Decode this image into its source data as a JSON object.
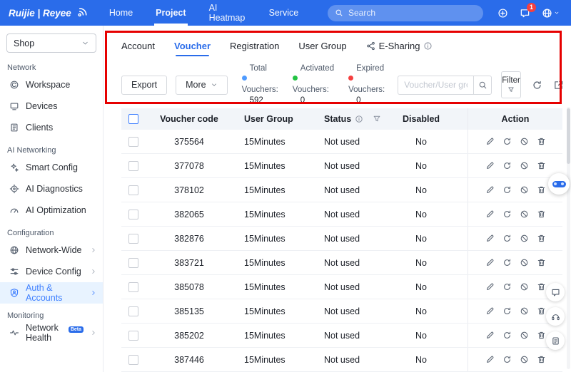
{
  "topbar": {
    "brand": "Ruijie | Reyee",
    "nav": [
      {
        "label": "Home"
      },
      {
        "label": "Project"
      },
      {
        "label": "AI Heatmap"
      },
      {
        "label": "Service"
      }
    ],
    "search_placeholder": "Search",
    "notification_badge": "1"
  },
  "sidebar": {
    "shop_selector": "Shop",
    "sections": [
      {
        "label": "Network",
        "items": [
          {
            "label": "Workspace"
          },
          {
            "label": "Devices"
          },
          {
            "label": "Clients"
          }
        ]
      },
      {
        "label": "AI Networking",
        "items": [
          {
            "label": "Smart Config"
          },
          {
            "label": "AI Diagnostics"
          },
          {
            "label": "AI Optimization"
          }
        ]
      },
      {
        "label": "Configuration",
        "items": [
          {
            "label": "Network-Wide"
          },
          {
            "label": "Device Config"
          },
          {
            "label": "Auth & Accounts"
          }
        ]
      },
      {
        "label": "Monitoring",
        "items": [
          {
            "label": "Network Health",
            "badge": "Beta"
          }
        ]
      }
    ]
  },
  "tabs": [
    {
      "label": "Account"
    },
    {
      "label": "Voucher"
    },
    {
      "label": "Registration"
    },
    {
      "label": "User Group"
    },
    {
      "label": "E-Sharing"
    }
  ],
  "toolbar": {
    "export_label": "Export",
    "more_label": "More",
    "stats": [
      {
        "line1": "Total",
        "line2": "Vouchers:",
        "value": "592",
        "color": "#4f9bff"
      },
      {
        "line1": "Activated",
        "line2": "Vouchers:",
        "value": "0",
        "color": "#23c343"
      },
      {
        "line1": "Expired",
        "line2": "Vouchers:",
        "value": "0",
        "color": "#f53f3f"
      }
    ],
    "search_placeholder": "Voucher/User group",
    "filter_label": "Filter"
  },
  "table": {
    "columns": [
      "Voucher code",
      "User Group",
      "Status",
      "Disabled",
      "Action"
    ],
    "rows": [
      {
        "code": "375564",
        "group": "15Minutes",
        "status": "Not used",
        "disabled": "No"
      },
      {
        "code": "377078",
        "group": "15Minutes",
        "status": "Not used",
        "disabled": "No"
      },
      {
        "code": "378102",
        "group": "15Minutes",
        "status": "Not used",
        "disabled": "No"
      },
      {
        "code": "382065",
        "group": "15Minutes",
        "status": "Not used",
        "disabled": "No"
      },
      {
        "code": "382876",
        "group": "15Minutes",
        "status": "Not used",
        "disabled": "No"
      },
      {
        "code": "383721",
        "group": "15Minutes",
        "status": "Not used",
        "disabled": "No"
      },
      {
        "code": "385078",
        "group": "15Minutes",
        "status": "Not used",
        "disabled": "No"
      },
      {
        "code": "385135",
        "group": "15Minutes",
        "status": "Not used",
        "disabled": "No"
      },
      {
        "code": "385202",
        "group": "15Minutes",
        "status": "Not used",
        "disabled": "No"
      },
      {
        "code": "387446",
        "group": "15Minutes",
        "status": "Not used",
        "disabled": "No"
      }
    ]
  },
  "colors": {
    "topbar": "#2a6cea",
    "accent": "#2a6cea",
    "active_item_bg": "#e8f3ff",
    "annotation": "#e60000"
  }
}
